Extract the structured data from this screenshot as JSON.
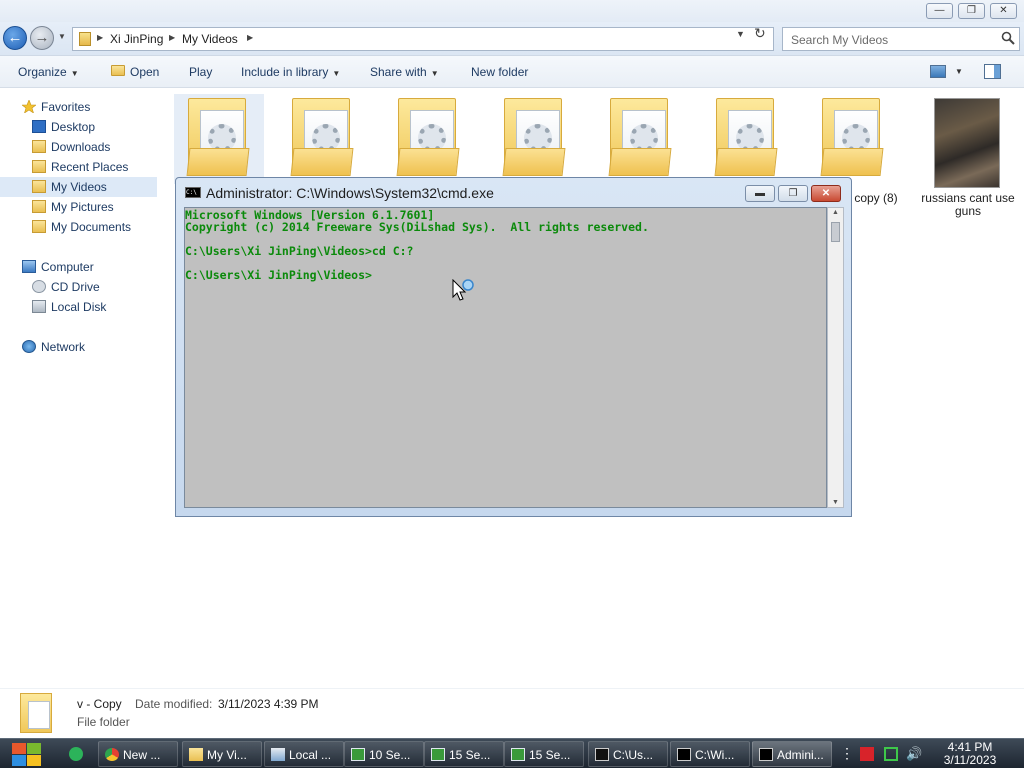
{
  "explorer": {
    "window_controls": {
      "minimize": "—",
      "maximize": "❐",
      "close": "✕"
    },
    "breadcrumb": [
      "Xi JinPing",
      "My Videos"
    ],
    "search_placeholder": "Search My Videos",
    "toolbar": {
      "organize": "Organize",
      "open": "Open",
      "play": "Play",
      "include_in_library": "Include in library",
      "share_with": "Share with",
      "new_folder": "New folder"
    },
    "nav": {
      "favorites": "Favorites",
      "desktop": "Desktop",
      "downloads": "Downloads",
      "recent_places": "Recent Places",
      "my_videos": "My Videos",
      "my_pictures": "My Pictures",
      "my_documents": "My Documents",
      "computer": "Computer",
      "cd_drive": "CD Drive",
      "local_disk": "Local Disk",
      "network": "Network"
    },
    "items": [
      {
        "label": ""
      },
      {
        "label": ""
      },
      {
        "label": ""
      },
      {
        "label": ""
      },
      {
        "label": ""
      },
      {
        "label": ""
      },
      {
        "label": "copy (8)"
      },
      {
        "label": "russians cant use guns"
      }
    ],
    "details": {
      "name": "v - Copy",
      "modified_label": "Date modified:",
      "modified_value": "3/11/2023 4:39 PM",
      "type": "File folder"
    }
  },
  "cmd": {
    "title": "Administrator: C:\\Windows\\System32\\cmd.exe",
    "icon_text": "C:\\",
    "lines": [
      "Microsoft Windows [Version 6.1.7601]",
      "Copyright (c) 2014 Freeware Sys(DiLshad Sys).  All rights reserved.",
      "",
      "C:\\Users\\Xi JinPing\\Videos>cd C:?",
      "",
      "C:\\Users\\Xi JinPing\\Videos>"
    ],
    "text_color": "#0b8a0b",
    "background_color": "#c0c0c0"
  },
  "taskbar": {
    "tasks": [
      {
        "label": "New ..."
      },
      {
        "label": "My Vi..."
      },
      {
        "label": "Local ..."
      },
      {
        "label": "10 Se..."
      },
      {
        "label": "15 Se..."
      },
      {
        "label": "15 Se..."
      },
      {
        "label": "C:\\Us..."
      },
      {
        "label": "C:\\Wi..."
      },
      {
        "label": "Admini..."
      }
    ],
    "clock_time": "4:41 PM",
    "clock_date": "3/11/2023"
  }
}
